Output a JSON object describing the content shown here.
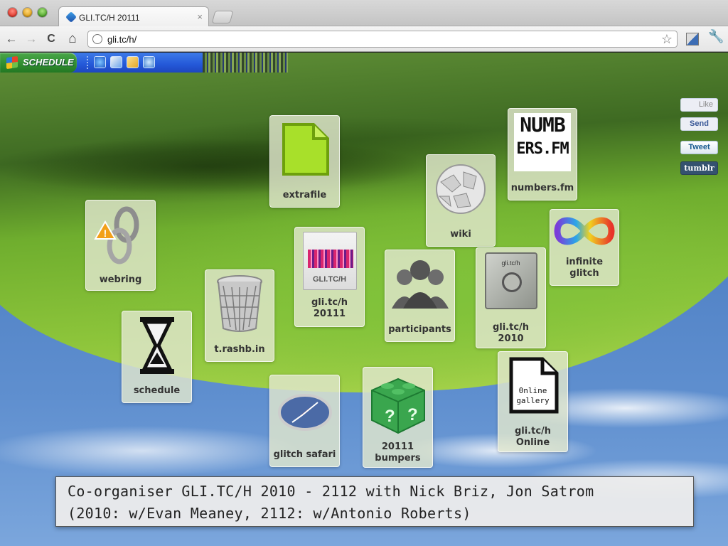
{
  "browser": {
    "tab_title": "GLI.TC/H 20111",
    "tab_close": "×",
    "url": "gli.tc/h/",
    "back": "←",
    "forward": "→",
    "reload": "C",
    "home": "⌂",
    "star": "☆",
    "wrench": "🔧"
  },
  "taskbar": {
    "start_label": "SCHEDULE",
    "quick_launch": [
      "ie-icon",
      "media-icon",
      "folder-icon",
      "messenger-icon"
    ]
  },
  "icons": [
    {
      "name": "extrafile",
      "label": "extrafile"
    },
    {
      "name": "numbers-fm",
      "label": "numbers.fm",
      "art_text": [
        "NUMB",
        "ERS.FM"
      ]
    },
    {
      "name": "wiki",
      "label": "wiki"
    },
    {
      "name": "webring",
      "label": "webring"
    },
    {
      "name": "gli-tc-h-20111",
      "label1": "gli.tc/h",
      "label2": "20111",
      "art_text": "GLI.TC/H"
    },
    {
      "name": "infinite-glitch",
      "label1": "infinite",
      "label2": "glitch"
    },
    {
      "name": "trash",
      "label": "t.rashb.in"
    },
    {
      "name": "participants",
      "label": "participants"
    },
    {
      "name": "gli-tc-h-2010",
      "label1": "gli.tc/h",
      "label2": "2010",
      "art_text": "gli.tc/h"
    },
    {
      "name": "schedule",
      "label": "schedule"
    },
    {
      "name": "glitch-safari",
      "label": "glitch safari"
    },
    {
      "name": "bumpers",
      "label1": "20111",
      "label2": "bumpers"
    },
    {
      "name": "online-gallery",
      "label1": "gli.tc/h",
      "label2": "Online",
      "art_text": [
        "0nline",
        "gallery"
      ]
    }
  ],
  "social": {
    "like": "Like",
    "send": "Send",
    "tweet": "Tweet",
    "tumblr": "tumblr"
  },
  "caption": {
    "line1": "Co-organiser GLI.TC/H 2010 - 2112 with Nick Briz, Jon Satrom",
    "line2": "(2010: w/Evan Meaney, 2112: w/Antonio Roberts)"
  },
  "colors": {
    "taskbar_blue": "#2458d8",
    "start_green": "#2f8c2f",
    "icon_tile": "#e0e6cd"
  }
}
